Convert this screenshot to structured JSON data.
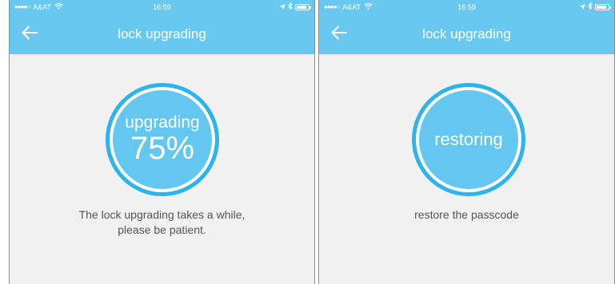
{
  "screens": [
    {
      "status_bar": {
        "signal": "●●●●○",
        "carrier": "A&AT",
        "time": "16:59"
      },
      "nav": {
        "title": "lock upgrading"
      },
      "circle": {
        "label": "upgrading",
        "percent": "75%",
        "progress": 0.75
      },
      "message": {
        "line1": "The lock upgrading takes a while,",
        "line2": "please be patient."
      }
    },
    {
      "status_bar": {
        "signal": "●●●●○",
        "carrier": "A&AT",
        "time": "16:59"
      },
      "nav": {
        "title": "lock upgrading"
      },
      "circle": {
        "label": "restoring"
      },
      "message": {
        "line1": "restore the passcode"
      }
    }
  ],
  "colors": {
    "header": "#69c8f0",
    "circle_fill": "#63c7f0",
    "circle_ring": "#2eb3ea",
    "background": "#f1f1f1",
    "text": "#555555"
  },
  "icons": [
    "back-arrow-icon",
    "wifi-icon",
    "location-arrow-icon",
    "bluetooth-icon",
    "battery-icon"
  ]
}
